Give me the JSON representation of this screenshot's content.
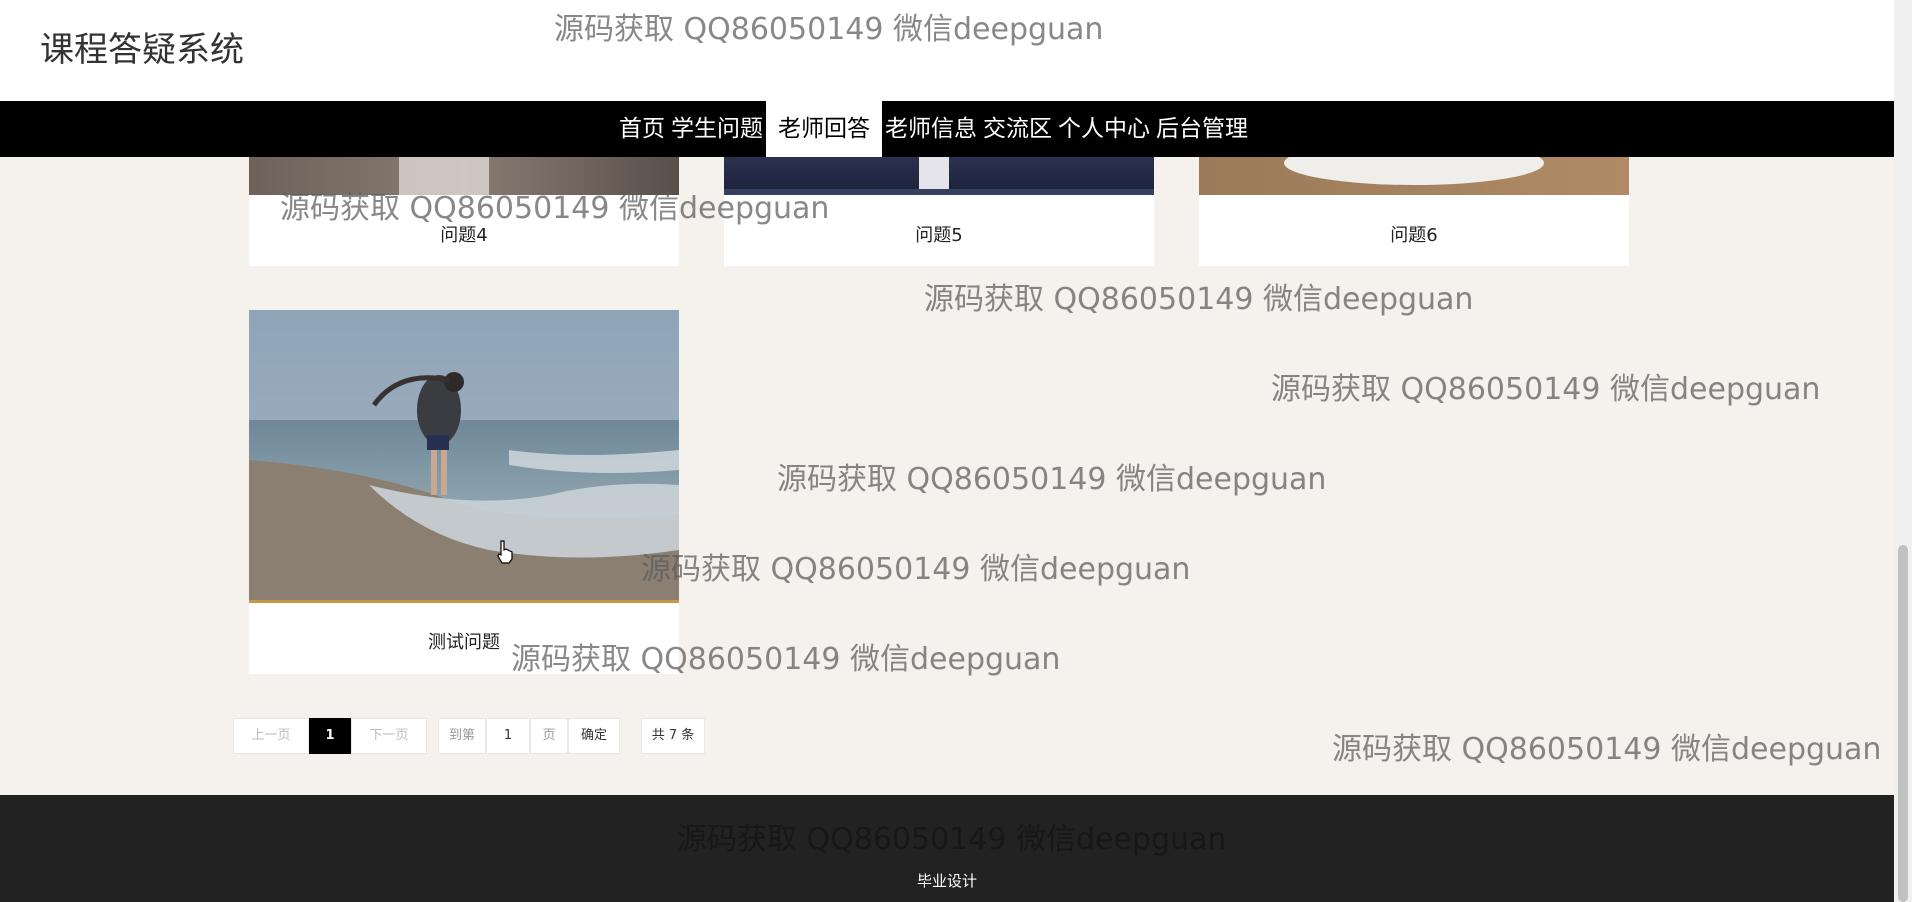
{
  "site": {
    "title": "课程答疑系统"
  },
  "nav": {
    "items": [
      {
        "label": "首页"
      },
      {
        "label": "学生问题"
      },
      {
        "label": "老师回答",
        "active": true
      },
      {
        "label": "老师信息"
      },
      {
        "label": "交流区"
      },
      {
        "label": "个人中心"
      },
      {
        "label": "后台管理"
      }
    ]
  },
  "cards": [
    {
      "caption": "问题4"
    },
    {
      "caption": "问题5"
    },
    {
      "caption": "问题6"
    },
    {
      "caption": "测试问题"
    }
  ],
  "pagination": {
    "prev": "上一页",
    "current": "1",
    "next": "下一页",
    "goto_prefix": "到第",
    "goto_value": "1",
    "goto_suffix": "页",
    "confirm": "确定",
    "total": "共 7 条"
  },
  "footer": {
    "text": "毕业设计"
  },
  "watermark": {
    "text": "源码获取 QQ86050149 微信deepguan"
  },
  "colors": {
    "nav_bg": "#000000",
    "page_bg": "#f5f1ed",
    "footer_bg": "#222222",
    "active_page": "#000000"
  }
}
